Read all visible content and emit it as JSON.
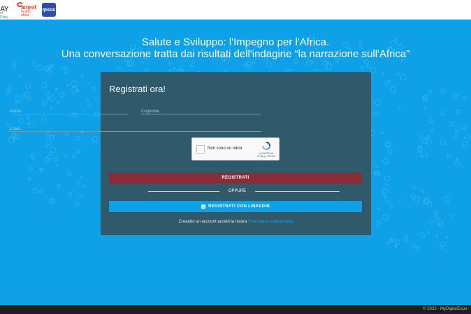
{
  "header": {
    "logos": {
      "day": {
        "text_main": "AY",
        "text_sub": "of Dialy"
      },
      "amref": {
        "text_main": "amref",
        "text_sub": "health africa"
      },
      "ipsos": {
        "text_main": "Ipsos"
      }
    }
  },
  "hero": {
    "line1": "Salute e Sviluppo: l'Impegno per l'Africa.",
    "line2": "Una conversazione tratta dai risultati dell'indagine “la narrazione sull'Africa”"
  },
  "form": {
    "title": "Registrati ora!",
    "nome_placeholder": "Nome",
    "cognome_placeholder": "Cognome",
    "email_placeholder": "Email",
    "recaptcha": {
      "label": "Non sono un robot",
      "brand": "reCAPTCHA",
      "links": "Privacy - Termini"
    },
    "register_label": "REGISTRATI",
    "or_label": "OPPURE",
    "linkedin_icon_text": "in",
    "linkedin_label": "REGISTRATI CON LINKEDIN",
    "consent_prefix": "Creando un account accetti la nostra ",
    "consent_link": "Informativa sulla privacy"
  },
  "footer": {
    "copyright": "© 2022 - MyDigitalExpo -"
  },
  "colors": {
    "background": "#0fa1e8",
    "panel": "#2e5a6c",
    "register_button": "#8a2d3b",
    "linkedin_button": "#0fa1e8",
    "link": "#1e9fe6"
  }
}
